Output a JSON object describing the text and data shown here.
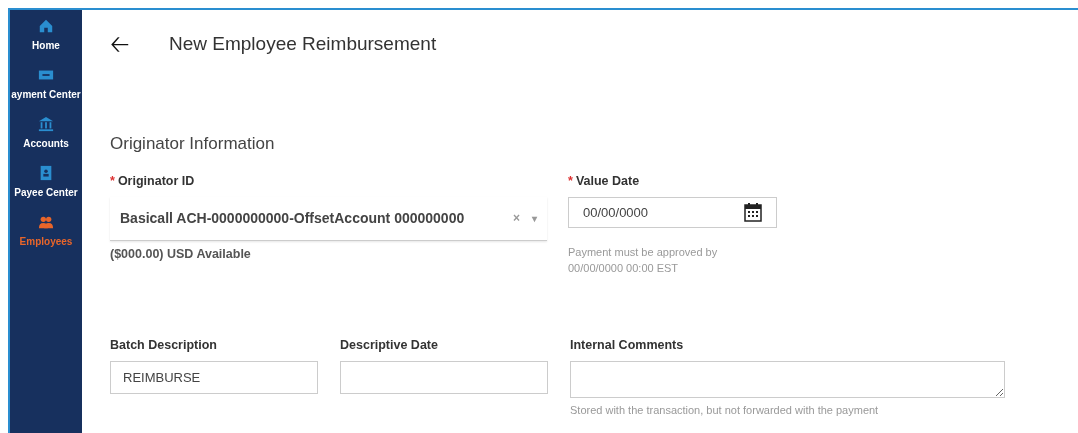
{
  "sidebar": {
    "items": [
      {
        "label": "Home",
        "selected": false
      },
      {
        "label": "ayment Center",
        "selected": false
      },
      {
        "label": "Accounts",
        "selected": false
      },
      {
        "label": "Payee Center",
        "selected": false
      },
      {
        "label": "Employees",
        "selected": true
      }
    ]
  },
  "header": {
    "back": "🡠",
    "title": "New Employee Reimbursement"
  },
  "section": {
    "title": "Originator Information"
  },
  "originator": {
    "label": "Originator ID",
    "required_mark": "*",
    "value": "Basicall ACH-0000000000-OffsetAccount 000000000",
    "clear": "×",
    "caret": "▾",
    "note": "($000.00) USD Available"
  },
  "value_date": {
    "label": "Value Date",
    "required_mark": "*",
    "value": "00/00/0000",
    "hint_lines": [
      "Payment must be approved by",
      "00/00/0000 00:00 EST"
    ]
  },
  "batch_description": {
    "label": "Batch Description",
    "value": "REIMBURSE"
  },
  "descriptive_date": {
    "label": "Descriptive Date"
  },
  "internal_comments": {
    "label": "Internal Comments",
    "hint": "Stored with the transaction, but not forwarded with the payment"
  }
}
